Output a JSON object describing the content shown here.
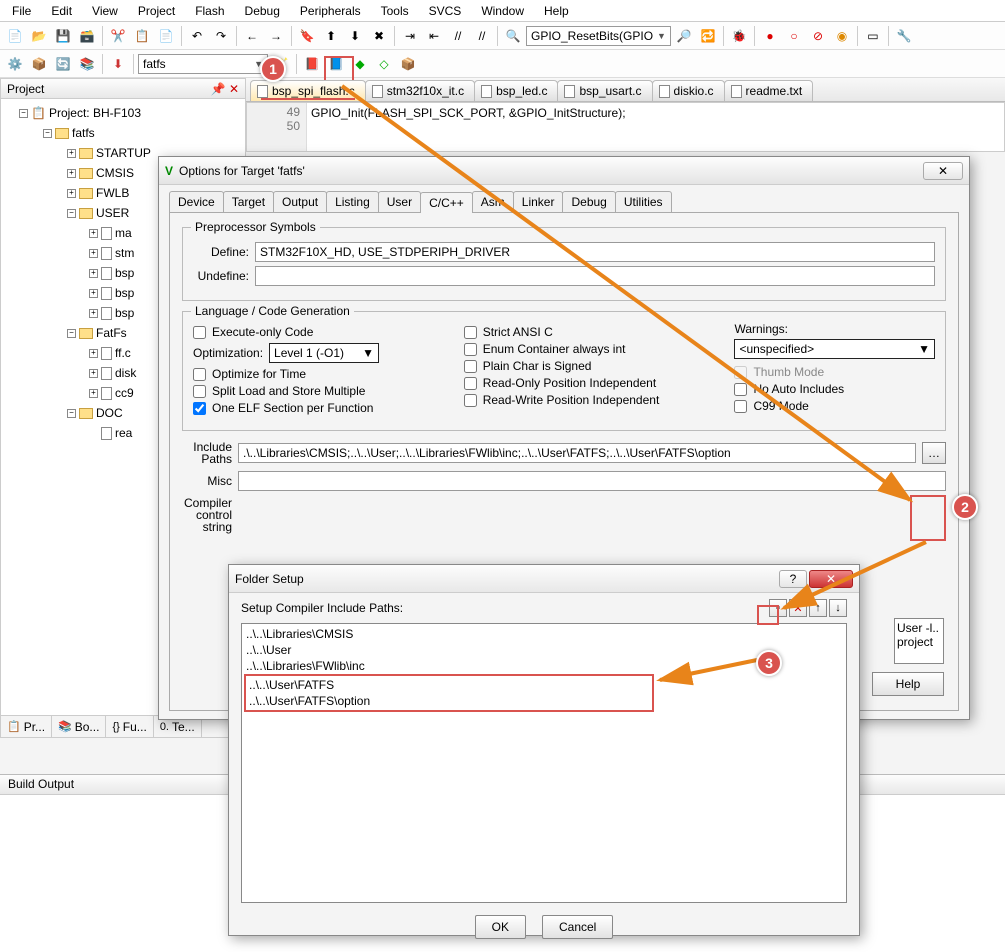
{
  "menubar": [
    "File",
    "Edit",
    "View",
    "Project",
    "Flash",
    "Debug",
    "Peripherals",
    "Tools",
    "SVCS",
    "Window",
    "Help"
  ],
  "toolbar_combo1": "GPIO_ResetBits(GPIO",
  "toolbar2_combo": "fatfs",
  "project_panel_title": "Project",
  "tree": {
    "root": "Project: BH-F103",
    "target": "fatfs",
    "groups": [
      "STARTUP",
      "CMSIS",
      "FWLB",
      "USER",
      "FatFs",
      "DOC"
    ],
    "user_files": [
      "ma",
      "stm",
      "bsp",
      "bsp",
      "bsp"
    ],
    "fatfs_files": [
      "ff.c",
      "disk",
      "cc9"
    ],
    "doc_file": "rea"
  },
  "bottom_tabs": [
    "Pr...",
    "Bo...",
    "Fu...",
    "Te..."
  ],
  "editor_tabs": [
    "bsp_spi_flash.c",
    "stm32f10x_it.c",
    "bsp_led.c",
    "bsp_usart.c",
    "diskio.c",
    "readme.txt"
  ],
  "code_gutter": [
    "49",
    "50"
  ],
  "code_line": "GPIO_Init(FLASH_SPI_SCK_PORT, &GPIO_InitStructure);",
  "build_output_title": "Build Output",
  "options_dialog": {
    "title": "Options for Target 'fatfs'",
    "tabs": [
      "Device",
      "Target",
      "Output",
      "Listing",
      "User",
      "C/C++",
      "Asm",
      "Linker",
      "Debug",
      "Utilities"
    ],
    "active_tab": "C/C++",
    "preproc_title": "Preprocessor Symbols",
    "define_label": "Define:",
    "define_value": "STM32F10X_HD, USE_STDPERIPH_DRIVER",
    "undefine_label": "Undefine:",
    "undefine_value": "",
    "lang_title": "Language / Code Generation",
    "execute_only": "Execute-only Code",
    "optimization_label": "Optimization:",
    "optimization_value": "Level 1 (-O1)",
    "optimize_time": "Optimize for Time",
    "split_load": "Split Load and Store Multiple",
    "one_elf": "One ELF Section per Function",
    "strict_ansi": "Strict ANSI C",
    "enum_container": "Enum Container always int",
    "plain_char": "Plain Char is Signed",
    "ro_pi": "Read-Only Position Independent",
    "rw_pi": "Read-Write Position Independent",
    "warnings_label": "Warnings:",
    "warnings_value": "<unspecified>",
    "thumb_mode": "Thumb Mode",
    "no_auto": "No Auto Includes",
    "c99_mode": "C99 Mode",
    "include_label": "Include\nPaths",
    "include_value": ".\\..\\Libraries\\CMSIS;..\\..\\User;..\\..\\Libraries\\FWlib\\inc;..\\..\\User\\FATFS;..\\..\\User\\FATFS\\option",
    "misc_label": "Misc",
    "compiler_label": "Compiler\ncontrol\nstring",
    "side_list": [
      "User -l..",
      "project"
    ],
    "help": "Help"
  },
  "folder_dialog": {
    "title": "Folder Setup",
    "subtitle": "Setup Compiler Include Paths:",
    "items": [
      "..\\..\\Libraries\\CMSIS",
      "..\\..\\User",
      "..\\..\\Libraries\\FWlib\\inc",
      "..\\..\\User\\FATFS",
      "..\\..\\User\\FATFS\\option"
    ],
    "ok": "OK",
    "cancel": "Cancel"
  },
  "callouts": {
    "one": "1",
    "two": "2",
    "three": "3"
  }
}
